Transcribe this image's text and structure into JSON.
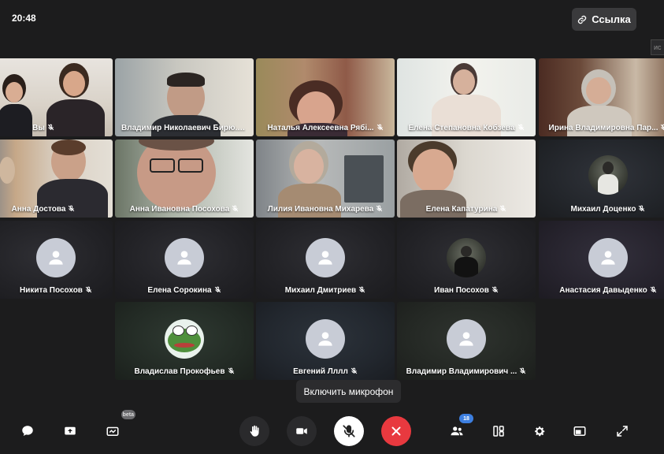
{
  "status": {
    "time": "20:48"
  },
  "header": {
    "link_label": "Ссылка",
    "side_hint": "ис"
  },
  "colors": {
    "leave": "#e8393f",
    "accent": "#3d7fe0",
    "tile_dark": "#222226",
    "avatar_placeholder": "#c8ccd6"
  },
  "participants": [
    {
      "name": "Вы",
      "kind": "video",
      "icon": "mic-off-icon"
    },
    {
      "name": "Владимир Николаевич Бирю...",
      "kind": "video",
      "icon": "mic-off-icon"
    },
    {
      "name": "Наталья Алексеевна Рябі...",
      "kind": "video",
      "icon": "mic-off-icon"
    },
    {
      "name": "Елена Степановна Кобзева",
      "kind": "video",
      "icon": "mic-off-icon"
    },
    {
      "name": "Ирина Владимировна Пар...",
      "kind": "video",
      "icon": "mic-off-icon"
    },
    {
      "name": "Анна Достова",
      "kind": "video",
      "icon": "mic-off-icon"
    },
    {
      "name": "Анна Ивановна Посохова",
      "kind": "video",
      "icon": "mic-off-icon"
    },
    {
      "name": "Лилия Ивановна Михарева",
      "kind": "video",
      "icon": "mic-off-icon"
    },
    {
      "name": "Елена Капатурина",
      "kind": "video",
      "icon": "mic-off-icon"
    },
    {
      "name": "Михаил Доценко",
      "kind": "avatar-photo",
      "icon": "mic-off-icon"
    },
    {
      "name": "Никита Посохов",
      "kind": "avatar",
      "icon": "mic-off-icon"
    },
    {
      "name": "Елена Сорокина",
      "kind": "avatar",
      "icon": "mic-off-icon"
    },
    {
      "name": "Михаил Дмитриев",
      "kind": "avatar",
      "icon": "mic-off-icon"
    },
    {
      "name": "Иван Посохов",
      "kind": "avatar-photo",
      "icon": "mic-off-icon"
    },
    {
      "name": "Анастасия Давыденко",
      "kind": "avatar",
      "icon": "mic-off-icon"
    },
    {
      "name": "Владислав Прокофьев",
      "kind": "avatar-frog",
      "icon": "mic-off-icon"
    },
    {
      "name": "Евгений Лллл",
      "kind": "avatar",
      "icon": "mic-off-icon"
    },
    {
      "name": "Владимир Владимирович ...",
      "kind": "avatar",
      "icon": "mic-off-icon"
    }
  ],
  "tooltip": {
    "text": "Включить микрофон"
  },
  "toolbar": {
    "chat_icon": "chat-icon",
    "share_icon": "screen-share-icon",
    "board_icon": "whiteboard-icon",
    "board_badge": "beta",
    "hand_icon": "raise-hand-icon",
    "camera_icon": "camera-icon",
    "mic_icon": "mic-off-icon",
    "leave_icon": "close-icon",
    "participants_icon": "participants-icon",
    "participants_count": "18",
    "layout_icon": "layout-icon",
    "settings_icon": "gear-icon",
    "pip_icon": "picture-in-picture-icon",
    "fullscreen_icon": "fullscreen-icon"
  }
}
